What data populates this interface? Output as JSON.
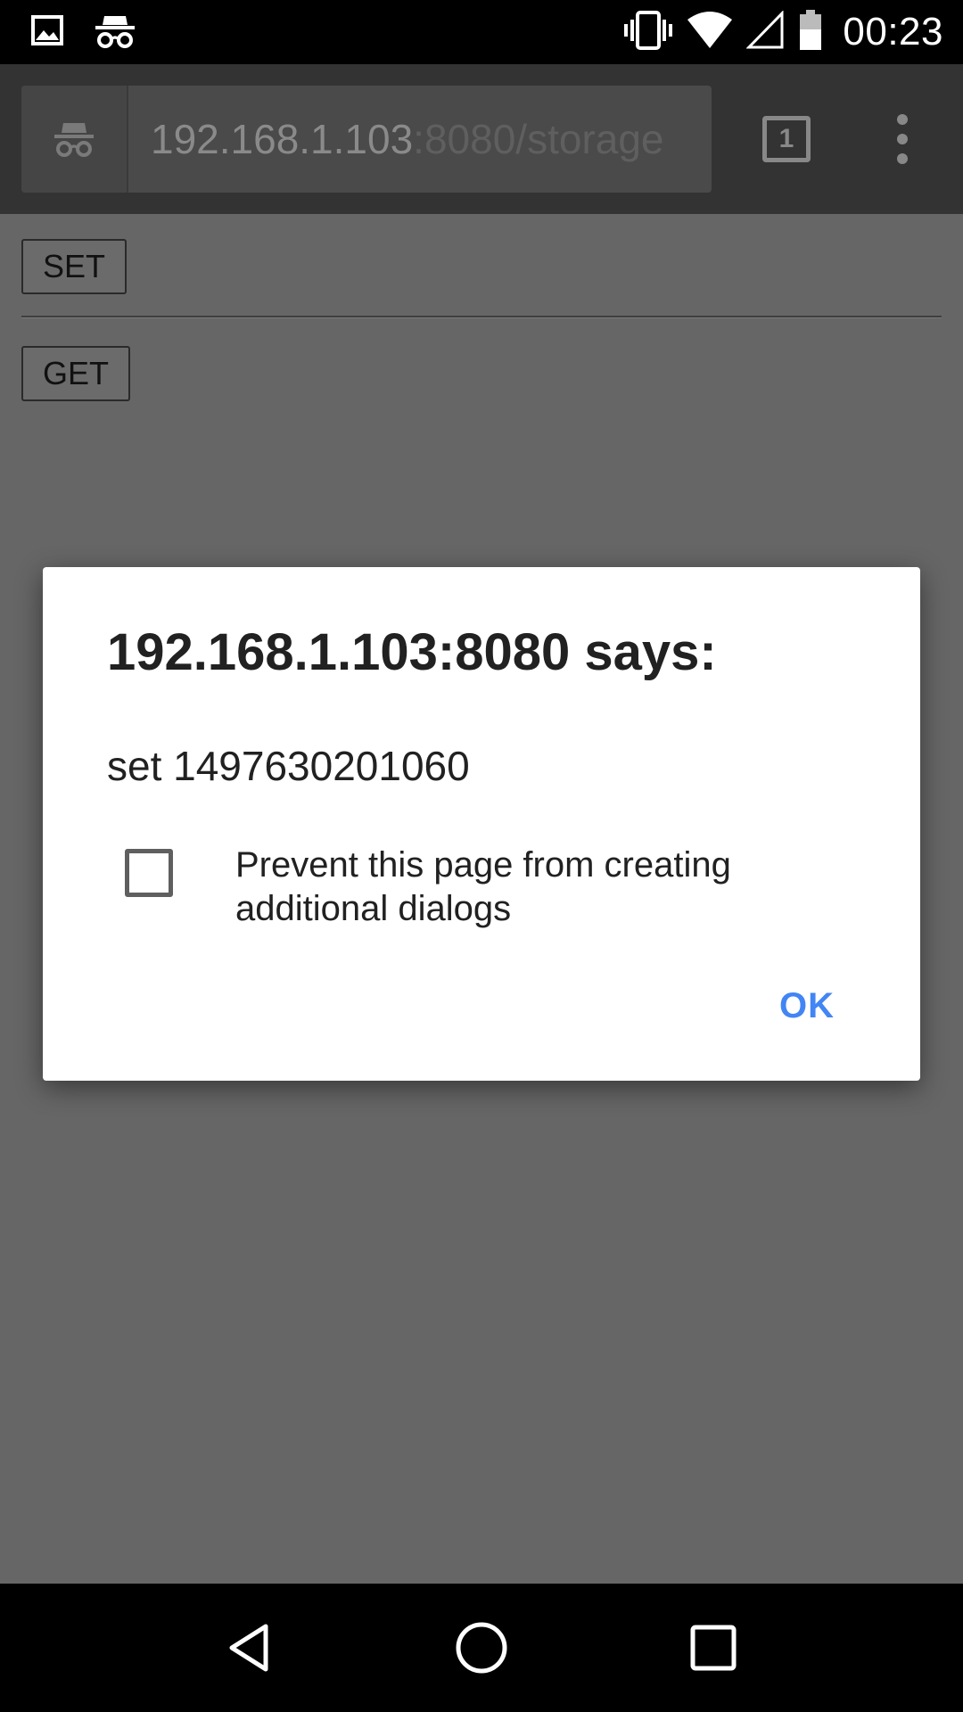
{
  "status_bar": {
    "time": "00:23",
    "left_icons": [
      "image-icon",
      "incognito-icon"
    ],
    "right_icons": [
      "vibrate-icon",
      "wifi-icon",
      "signal-icon",
      "battery-icon"
    ]
  },
  "browser": {
    "url_host": "192.168.1.103",
    "url_rest": ":8080/storage",
    "tab_count": "1",
    "incognito": true
  },
  "page": {
    "set_button": "SET",
    "get_button": "GET"
  },
  "dialog": {
    "title": "192.168.1.103:8080 says:",
    "message": "set 1497630201060",
    "checkbox_label": "Prevent this page from creating additional dialogs",
    "checkbox_checked": false,
    "ok_label": "OK"
  },
  "nav_bar": {
    "buttons": [
      "back-icon",
      "home-icon",
      "recents-icon"
    ]
  },
  "colors": {
    "accent": "#4285f4",
    "dim_page": "#666666",
    "toolbar": "#333333"
  }
}
